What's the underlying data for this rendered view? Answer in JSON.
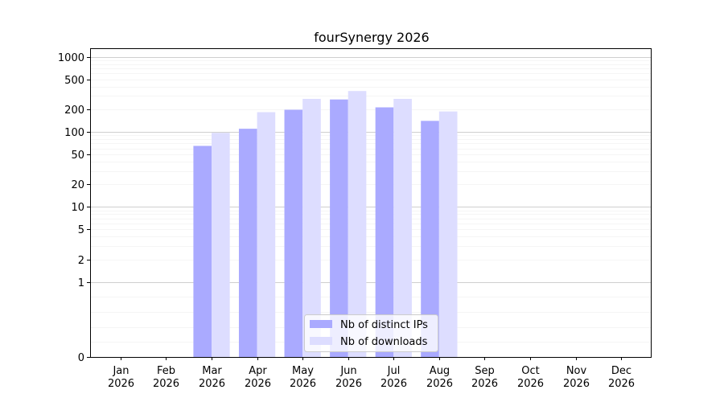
{
  "chart_data": {
    "type": "bar",
    "title": "fourSynergy 2026",
    "xlabel": "",
    "ylabel": "",
    "y_scale": "symlog",
    "ylim": [
      0,
      1300
    ],
    "y_ticks": [
      0,
      1,
      2,
      5,
      10,
      20,
      50,
      100,
      200,
      500,
      1000
    ],
    "y_tick_labels": [
      "0",
      "1",
      "2",
      "5",
      "10",
      "20",
      "50",
      "100",
      "200",
      "500",
      "1000"
    ],
    "grid": true,
    "legend_position": "bottom-center",
    "categories": [
      [
        "Jan",
        "2026"
      ],
      [
        "Feb",
        "2026"
      ],
      [
        "Mar",
        "2026"
      ],
      [
        "Apr",
        "2026"
      ],
      [
        "May",
        "2026"
      ],
      [
        "Jun",
        "2026"
      ],
      [
        "Jul",
        "2026"
      ],
      [
        "Aug",
        "2026"
      ],
      [
        "Sep",
        "2026"
      ],
      [
        "Oct",
        "2026"
      ],
      [
        "Nov",
        "2026"
      ],
      [
        "Dec",
        "2026"
      ]
    ],
    "series": [
      {
        "name": "Nb of distinct IPs",
        "color": "#aaaaff",
        "values": [
          0,
          0,
          65,
          110,
          197,
          270,
          212,
          140,
          0,
          0,
          0,
          0
        ]
      },
      {
        "name": "Nb of downloads",
        "color": "#ddddff",
        "values": [
          0,
          0,
          97,
          183,
          275,
          350,
          275,
          187,
          0,
          0,
          0,
          0
        ]
      }
    ]
  }
}
